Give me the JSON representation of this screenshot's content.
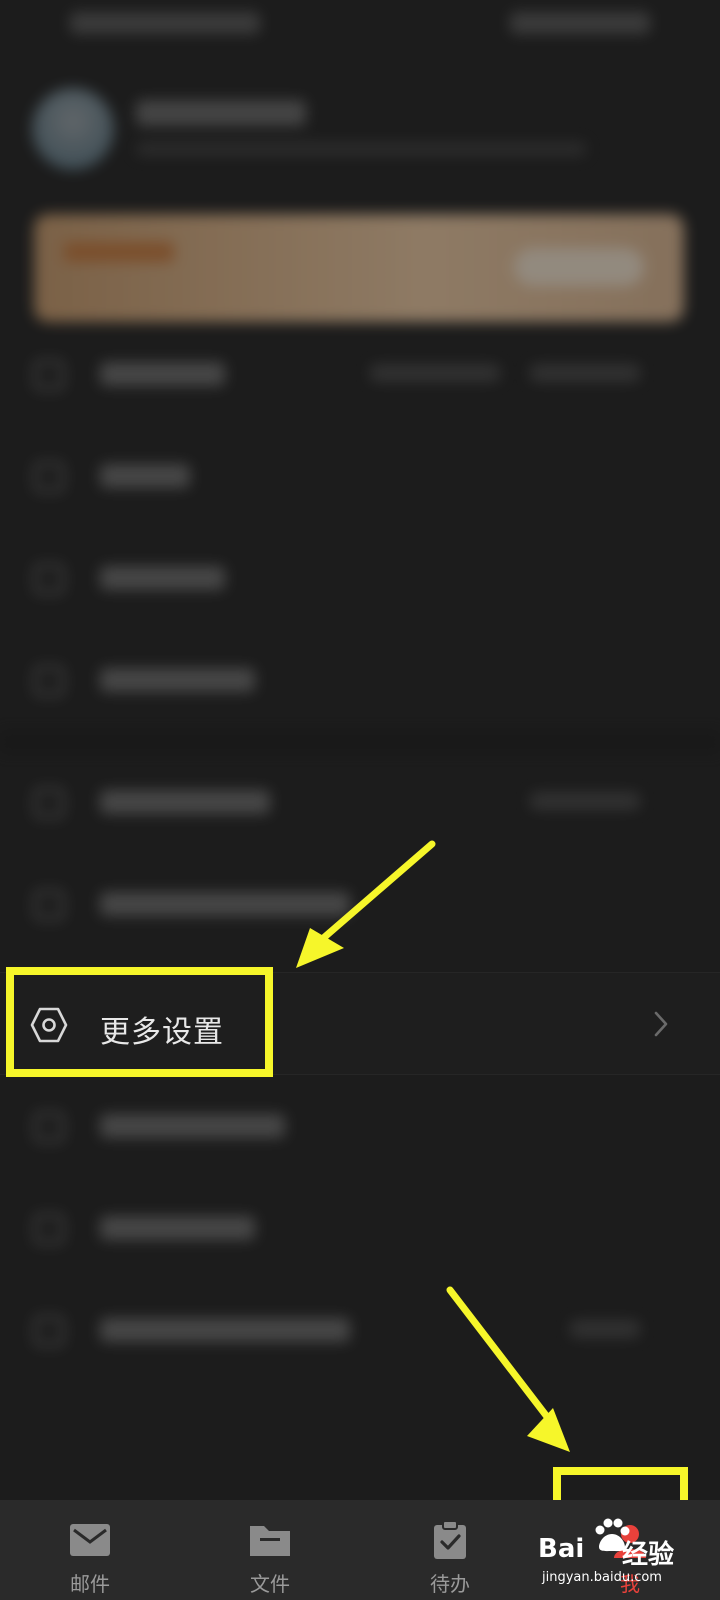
{
  "settings": {
    "more_settings_label": "更多设置"
  },
  "tabbar": {
    "tabs": [
      {
        "label": "邮件",
        "icon": "mail-icon"
      },
      {
        "label": "文件",
        "icon": "folder-icon"
      },
      {
        "label": "待办",
        "icon": "clipboard-check-icon"
      },
      {
        "label": "我",
        "icon": "profile-icon"
      }
    ],
    "active_color": "#e8413b"
  },
  "watermark": {
    "brand": "Bai",
    "sub": "jingyan.baidu.com",
    "suffix": "经验"
  },
  "annotation": {
    "highlight_color": "#f6f62a"
  }
}
